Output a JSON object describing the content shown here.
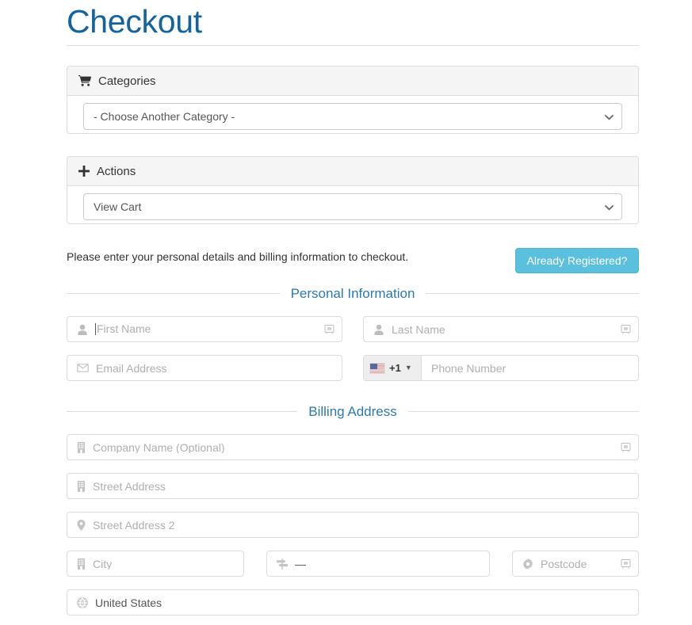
{
  "page": {
    "title": "Checkout"
  },
  "panels": [
    {
      "id": "categories",
      "icon": "shopping-cart-icon",
      "title": "Categories",
      "select_value": "- Choose Another Category -"
    },
    {
      "id": "actions",
      "icon": "plus-icon",
      "title": "Actions",
      "select_value": "View Cart"
    }
  ],
  "intro": {
    "text": "Please enter your personal details and billing information to checkout.",
    "registered_button": "Already Registered?"
  },
  "sections": {
    "personal": {
      "legend": "Personal Information",
      "fields": {
        "first_name": {
          "placeholder": "First Name",
          "value": "",
          "icon": "user-icon"
        },
        "last_name": {
          "placeholder": "Last Name",
          "value": "",
          "icon": "user-icon"
        },
        "email": {
          "placeholder": "Email Address",
          "value": "",
          "icon": "envelope-icon"
        },
        "phone": {
          "placeholder": "Phone Number",
          "value": "",
          "dial_code": "+1",
          "flag": "us-flag-icon"
        }
      }
    },
    "billing": {
      "legend": "Billing Address",
      "fields": {
        "company": {
          "placeholder": "Company Name (Optional)",
          "value": "",
          "icon": "building-icon"
        },
        "street": {
          "placeholder": "Street Address",
          "value": "",
          "icon": "building-icon"
        },
        "street2": {
          "placeholder": "Street Address 2",
          "value": "",
          "icon": "map-marker-icon"
        },
        "city": {
          "placeholder": "City",
          "value": "",
          "icon": "building-icon"
        },
        "state": {
          "placeholder": "",
          "value": "—",
          "icon": "map-signs-icon"
        },
        "postcode": {
          "placeholder": "Postcode",
          "value": "",
          "icon": "gear-icon"
        },
        "country": {
          "placeholder": "",
          "value": "United States",
          "icon": "globe-icon"
        }
      }
    }
  },
  "colors": {
    "title_blue": "#12639f",
    "legend_blue": "#2a7ab0",
    "info_button": "#5bc0de",
    "panel_heading_bg": "#f5f5f5",
    "border": "#dddddd"
  }
}
